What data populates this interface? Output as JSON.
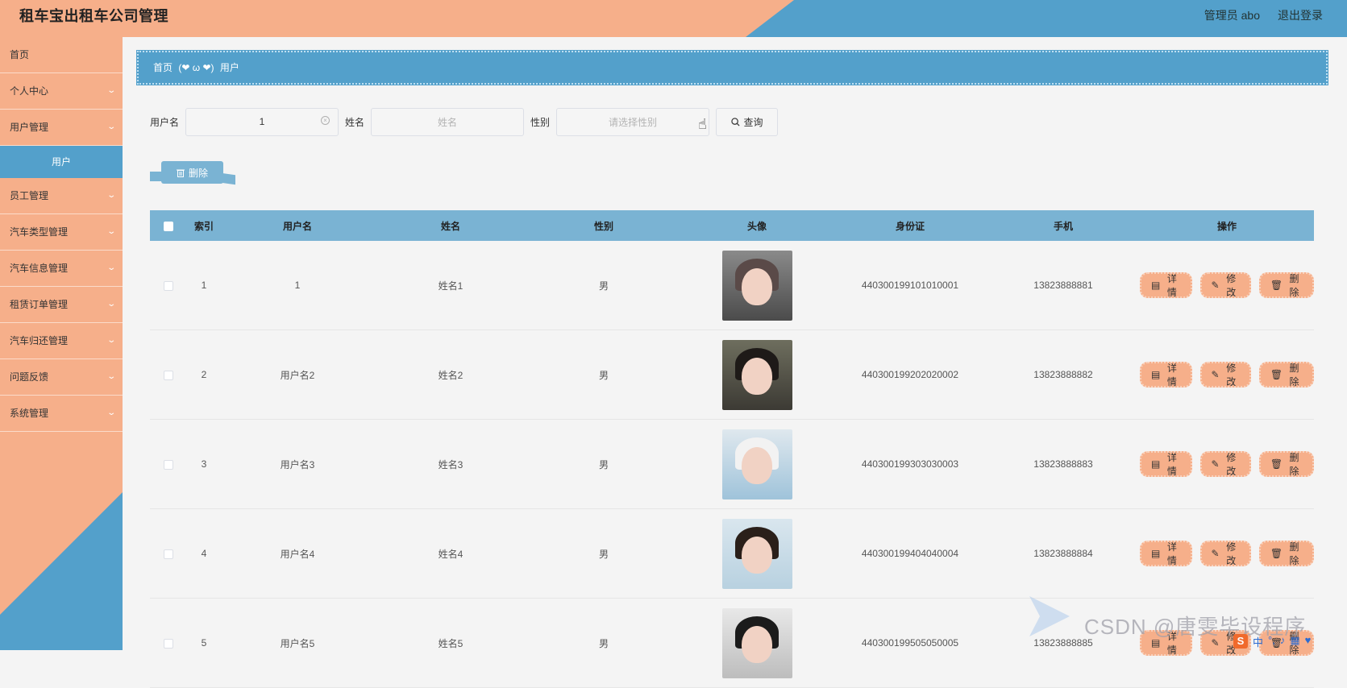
{
  "header": {
    "title": "租车宝出租车公司管理",
    "user_label": "管理员 abo",
    "logout_label": "退出登录"
  },
  "sidebar": {
    "items": [
      {
        "label": "首页",
        "has_children": false
      },
      {
        "label": "个人中心",
        "has_children": true
      },
      {
        "label": "用户管理",
        "has_children": true
      },
      {
        "label": "员工管理",
        "has_children": true
      },
      {
        "label": "汽车类型管理",
        "has_children": true
      },
      {
        "label": "汽车信息管理",
        "has_children": true
      },
      {
        "label": "租赁订单管理",
        "has_children": true
      },
      {
        "label": "汽车归还管理",
        "has_children": true
      },
      {
        "label": "问题反馈",
        "has_children": true
      },
      {
        "label": "系统管理",
        "has_children": true
      }
    ],
    "active_sub": "用户"
  },
  "breadcrumb": {
    "home": "首页",
    "separator": "(❤ ω ❤)",
    "current": "用户"
  },
  "search": {
    "username_label": "用户名",
    "username_value": "1",
    "name_label": "姓名",
    "name_placeholder": "姓名",
    "gender_label": "性别",
    "gender_placeholder": "请选择性别",
    "query_label": "查询"
  },
  "toolbar": {
    "delete_label": "删除"
  },
  "table": {
    "columns": [
      "索引",
      "用户名",
      "姓名",
      "性别",
      "头像",
      "身份证",
      "手机",
      "操作"
    ],
    "rows": [
      {
        "index": "1",
        "username": "1",
        "name": "姓名1",
        "gender": "男",
        "id_card": "440300199101010001",
        "phone": "13823888881"
      },
      {
        "index": "2",
        "username": "用户名2",
        "name": "姓名2",
        "gender": "男",
        "id_card": "440300199202020002",
        "phone": "13823888882"
      },
      {
        "index": "3",
        "username": "用户名3",
        "name": "姓名3",
        "gender": "男",
        "id_card": "440300199303030003",
        "phone": "13823888883"
      },
      {
        "index": "4",
        "username": "用户名4",
        "name": "姓名4",
        "gender": "男",
        "id_card": "440300199404040004",
        "phone": "13823888884"
      },
      {
        "index": "5",
        "username": "用户名5",
        "name": "姓名5",
        "gender": "男",
        "id_card": "440300199505050005",
        "phone": "13823888885"
      }
    ],
    "actions": {
      "detail": "详情",
      "edit": "修改",
      "delete": "删除"
    }
  },
  "watermark": {
    "text": "CSDN @唐雯毕设程序"
  },
  "ime": {
    "lang": "中"
  },
  "colors": {
    "peach": "#f6af8a",
    "blue": "#53a0cb",
    "table_header": "#7ab3d3"
  }
}
